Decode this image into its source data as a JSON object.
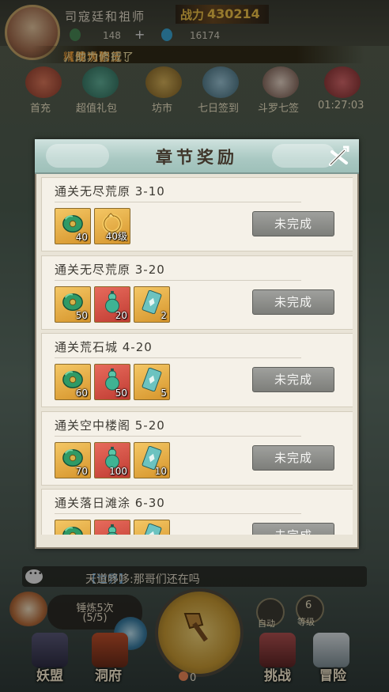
{
  "player": {
    "name": "司寇廷和祖师",
    "power_label": "战力",
    "power_value": "430214",
    "resource1": "148",
    "resource2": "16174"
  },
  "notice": {
    "prefix": "人成功合成了",
    "tag": "【传说】",
    "item": "精怪大明王",
    "suffix": "，助力修行！"
  },
  "top_menu": [
    {
      "label": "首充",
      "icon": "first-charge-icon"
    },
    {
      "label": "超值礼包",
      "icon": "gift-pack-icon"
    },
    {
      "label": "坊市",
      "icon": "market-icon"
    },
    {
      "label": "七日签到",
      "icon": "checkin-icon"
    },
    {
      "label": "斗罗七签",
      "icon": "character-icon"
    },
    {
      "label": "01:27:03",
      "icon": "timer-event-icon"
    }
  ],
  "modal": {
    "title": "章节奖励",
    "rows": [
      {
        "title": "通关无尽荒原 3-10",
        "rewards": [
          {
            "type": "jade",
            "count": "40",
            "bg": "gold"
          },
          {
            "type": "gold-ring",
            "count": "40级",
            "bg": "gold"
          }
        ],
        "status": "未完成"
      },
      {
        "title": "通关无尽荒原 3-20",
        "rewards": [
          {
            "type": "jade",
            "count": "50",
            "bg": "gold"
          },
          {
            "type": "gourd",
            "count": "20",
            "bg": "red"
          },
          {
            "type": "scroll",
            "count": "2",
            "bg": "gold"
          }
        ],
        "status": "未完成"
      },
      {
        "title": "通关荒石城 4-20",
        "rewards": [
          {
            "type": "jade",
            "count": "60",
            "bg": "gold"
          },
          {
            "type": "gourd",
            "count": "50",
            "bg": "red"
          },
          {
            "type": "scroll",
            "count": "5",
            "bg": "gold"
          }
        ],
        "status": "未完成"
      },
      {
        "title": "通关空中楼阁 5-20",
        "rewards": [
          {
            "type": "jade",
            "count": "70",
            "bg": "gold"
          },
          {
            "type": "gourd",
            "count": "100",
            "bg": "red"
          },
          {
            "type": "scroll",
            "count": "10",
            "bg": "gold"
          }
        ],
        "status": "未完成"
      },
      {
        "title": "通关落日滩涂 6-30",
        "rewards": [
          {
            "type": "jade",
            "count": "",
            "bg": "gold"
          },
          {
            "type": "gourd",
            "count": "",
            "bg": "red"
          },
          {
            "type": "scroll",
            "count": "",
            "bg": "gold"
          }
        ],
        "status": "未完成"
      }
    ]
  },
  "chat": {
    "channel": "【世界】",
    "message": "天道哆哆:那哥们还在吗"
  },
  "forge": {
    "label": "锤炼5次",
    "count": "(5/5)"
  },
  "center_count": "0",
  "side_buttons": [
    {
      "label": "自动"
    },
    {
      "label": "等级",
      "badge": "6"
    }
  ],
  "bottom_nav": [
    {
      "label": "妖盟"
    },
    {
      "label": "洞府"
    },
    {
      "label": "挑战"
    },
    {
      "label": "冒险"
    }
  ],
  "colors": {
    "modal_bg": "#e9e4d7",
    "header_teal": "#a9c8c2",
    "button_gray": "#8e8f8b",
    "reward_gold": "#e3ad47",
    "reward_red": "#d4524a"
  }
}
